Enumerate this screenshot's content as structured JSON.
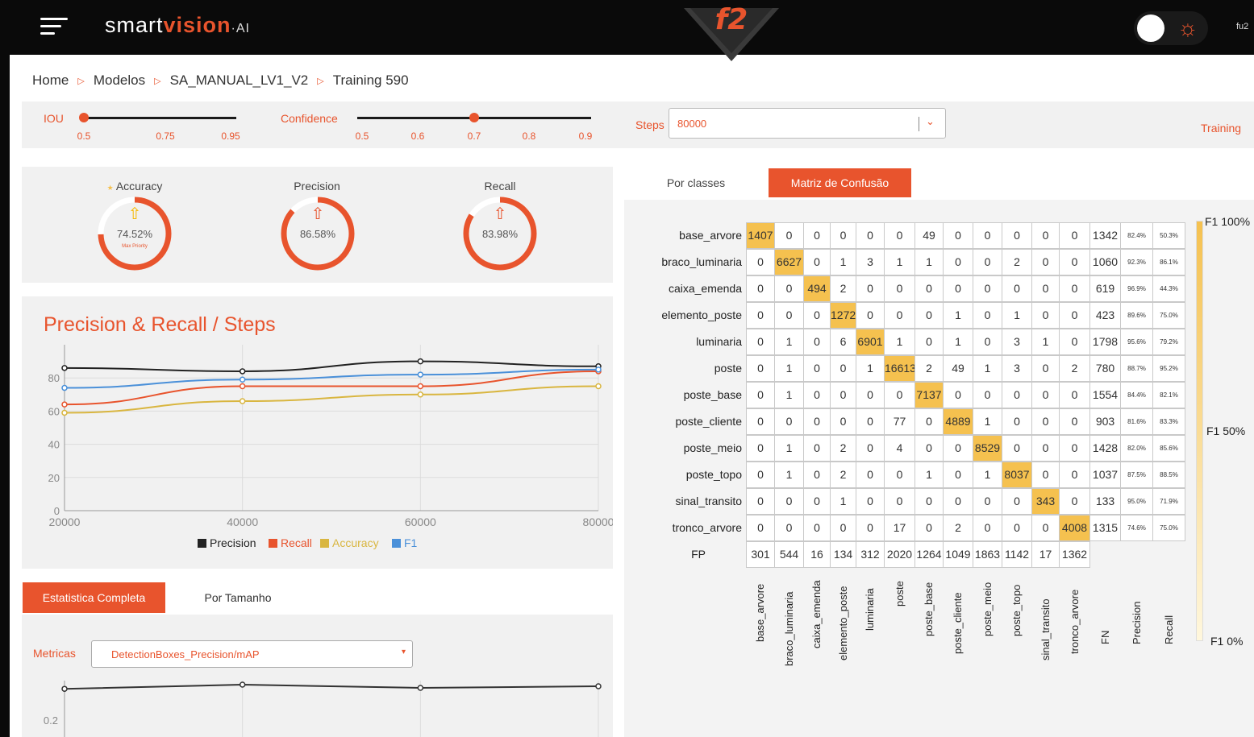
{
  "header": {
    "logo_prefix": "smart",
    "logo_accent": "vision",
    "logo_suffix": "·AI",
    "center_badge": "f2",
    "user": "fu2"
  },
  "breadcrumb": [
    "Home",
    "Modelos",
    "SA_MANUAL_LV1_V2",
    "Training 590"
  ],
  "filters": {
    "iou_label": "IOU",
    "iou_ticks": [
      "0.5",
      "0.75",
      "0.95"
    ],
    "iou_value": 0.5,
    "confidence_label": "Confidence",
    "confidence_ticks": [
      "0.5",
      "0.6",
      "0.7",
      "0.8",
      "0.9"
    ],
    "confidence_value": 0.7,
    "steps_label": "Steps",
    "steps_value": "80000",
    "training_label": "Training"
  },
  "metrics": [
    {
      "name": "Accuracy",
      "value": "74.52%",
      "sub": "Max Priority",
      "fraction": 0.7452
    },
    {
      "name": "Precision",
      "value": "86.58%",
      "fraction": 0.8658
    },
    {
      "name": "Recall",
      "value": "83.98%",
      "fraction": 0.8398
    }
  ],
  "colors": {
    "accent": "#e8542d",
    "diag": "#f5c14f",
    "precision": "#222222",
    "recall": "#e8542d",
    "accuracy": "#d9b640",
    "f1": "#4a90d9"
  },
  "chart_data": [
    {
      "type": "line",
      "title": "Precision & Recall / Steps",
      "x": [
        20000,
        40000,
        60000,
        80000
      ],
      "xlim": [
        20000,
        80000
      ],
      "ylim": [
        0,
        100
      ],
      "x_ticks": [
        "20000",
        "40000",
        "60000",
        "80000"
      ],
      "y_ticks": [
        "0",
        "20",
        "40",
        "60",
        "80"
      ],
      "legend_position": "bottom",
      "grid": true,
      "series": [
        {
          "name": "Precision",
          "color": "#222222",
          "values": [
            86,
            84,
            90,
            87
          ]
        },
        {
          "name": "Recall",
          "color": "#e8542d",
          "values": [
            64,
            75,
            75,
            84
          ]
        },
        {
          "name": "Accuracy",
          "color": "#d9b640",
          "values": [
            59,
            66,
            70,
            75
          ]
        },
        {
          "name": "F1",
          "color": "#4a90d9",
          "values": [
            74,
            79,
            82,
            85
          ]
        }
      ]
    },
    {
      "type": "line",
      "x": [
        20000,
        40000,
        60000,
        80000
      ],
      "ylim": [
        0.1,
        0.35
      ],
      "y_ticks": [
        "0.2"
      ],
      "series": [
        {
          "color": "#333333",
          "values": [
            0.297,
            0.31,
            0.3,
            0.305
          ]
        }
      ]
    }
  ],
  "bottom": {
    "tab_active": "Estatistica Completa",
    "tab_other": "Por Tamanho",
    "metricas_label": "Metricas",
    "metricas_value": "DetectionBoxes_Precision/mAP"
  },
  "right": {
    "tab_other": "Por classes",
    "tab_active": "Matriz de Confusão",
    "f1_top": "F1 100%",
    "f1_mid": "F1 50%",
    "f1_bottom": "F1 0%"
  },
  "matrix": {
    "rows": [
      "base_arvore",
      "braco_luminaria",
      "caixa_emenda",
      "elemento_poste",
      "luminaria",
      "poste",
      "poste_base",
      "poste_cliente",
      "poste_meio",
      "poste_topo",
      "sinal_transito",
      "tronco_arvore"
    ],
    "columns": [
      "base_arvore",
      "braco_luminaria",
      "caixa_emenda",
      "elemento_poste",
      "luminaria",
      "poste",
      "poste_base",
      "poste_cliente",
      "poste_meio",
      "poste_topo",
      "sinal_transito",
      "tronco_arvore",
      "FN",
      "Precision",
      "Recall"
    ],
    "fp_label": "FP",
    "values": [
      [
        "1407",
        "0",
        "0",
        "0",
        "0",
        "0",
        "49",
        "0",
        "0",
        "0",
        "0",
        "0",
        "1342",
        "82.4%",
        "50.3%"
      ],
      [
        "0",
        "6627",
        "0",
        "1",
        "3",
        "1",
        "1",
        "0",
        "0",
        "2",
        "0",
        "0",
        "1060",
        "92.3%",
        "86.1%"
      ],
      [
        "0",
        "0",
        "494",
        "2",
        "0",
        "0",
        "0",
        "0",
        "0",
        "0",
        "0",
        "0",
        "619",
        "96.9%",
        "44.3%"
      ],
      [
        "0",
        "0",
        "0",
        "1272",
        "0",
        "0",
        "0",
        "1",
        "0",
        "1",
        "0",
        "0",
        "423",
        "89.6%",
        "75.0%"
      ],
      [
        "0",
        "1",
        "0",
        "6",
        "6901",
        "1",
        "0",
        "1",
        "0",
        "3",
        "1",
        "0",
        "1798",
        "95.6%",
        "79.2%"
      ],
      [
        "0",
        "1",
        "0",
        "0",
        "1",
        "16613",
        "2",
        "49",
        "1",
        "3",
        "0",
        "2",
        "780",
        "88.7%",
        "95.2%"
      ],
      [
        "0",
        "1",
        "0",
        "0",
        "0",
        "0",
        "7137",
        "0",
        "0",
        "0",
        "0",
        "0",
        "1554",
        "84.4%",
        "82.1%"
      ],
      [
        "0",
        "0",
        "0",
        "0",
        "0",
        "77",
        "0",
        "4889",
        "1",
        "0",
        "0",
        "0",
        "903",
        "81.6%",
        "83.3%"
      ],
      [
        "0",
        "1",
        "0",
        "2",
        "0",
        "4",
        "0",
        "0",
        "8529",
        "0",
        "0",
        "0",
        "1428",
        "82.0%",
        "85.6%"
      ],
      [
        "0",
        "1",
        "0",
        "2",
        "0",
        "0",
        "1",
        "0",
        "1",
        "8037",
        "0",
        "0",
        "1037",
        "87.5%",
        "88.5%"
      ],
      [
        "0",
        "0",
        "0",
        "1",
        "0",
        "0",
        "0",
        "0",
        "0",
        "0",
        "343",
        "0",
        "133",
        "95.0%",
        "71.9%"
      ],
      [
        "0",
        "0",
        "0",
        "0",
        "0",
        "17",
        "0",
        "2",
        "0",
        "0",
        "0",
        "4008",
        "1315",
        "74.6%",
        "75.0%"
      ]
    ],
    "fp": [
      "301",
      "544",
      "16",
      "134",
      "312",
      "2020",
      "1264",
      "1049",
      "1863",
      "1142",
      "17",
      "1362"
    ]
  }
}
